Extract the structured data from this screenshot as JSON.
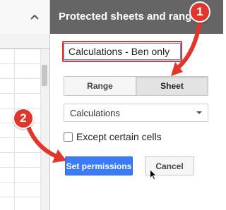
{
  "panel": {
    "title": "Protected sheets and ranges",
    "name_value": "Calculations - Ben only",
    "tabs": [
      {
        "label": "Range",
        "active": false
      },
      {
        "label": "Sheet",
        "active": true
      }
    ],
    "sheet_select": {
      "selected": "Calculations"
    },
    "except_cells": {
      "label": "Except certain cells",
      "checked": false
    },
    "set_permissions_label": "Set permissions",
    "cancel_label": "Cancel"
  },
  "annotations": {
    "step1": "1",
    "step2": "2"
  },
  "colors": {
    "header_bg": "#656565",
    "primary": "#3b7cf6",
    "annotation_red": "#e0362c"
  },
  "icons": {
    "collapse": "chevron-up-icon",
    "dropdown": "caret-down-icon",
    "pointer": "mouse-cursor-icon"
  }
}
